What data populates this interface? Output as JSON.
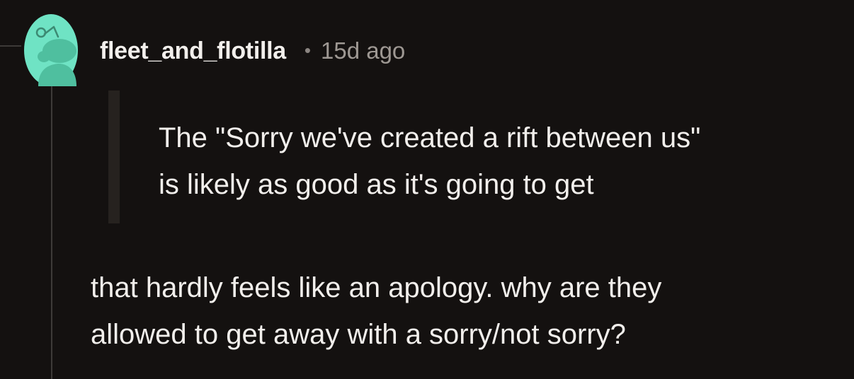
{
  "comment": {
    "author": "fleet_and_flotilla",
    "separator": "•",
    "timestamp": "15d ago",
    "avatar_icon": "snoo-avatar-icon",
    "quote_lines": [
      "The \"Sorry we've created a rift between us\"",
      "is likely as good as it's going to get"
    ],
    "body_lines": [
      "that hardly feels like an apology. why are they",
      "allowed to get away with a sorry/not sorry?"
    ]
  },
  "colors": {
    "background": "#141110",
    "text": "#f2efec",
    "muted": "#9e9893",
    "avatar": "#6fe3c4",
    "thread_line": "#3d3a38"
  }
}
